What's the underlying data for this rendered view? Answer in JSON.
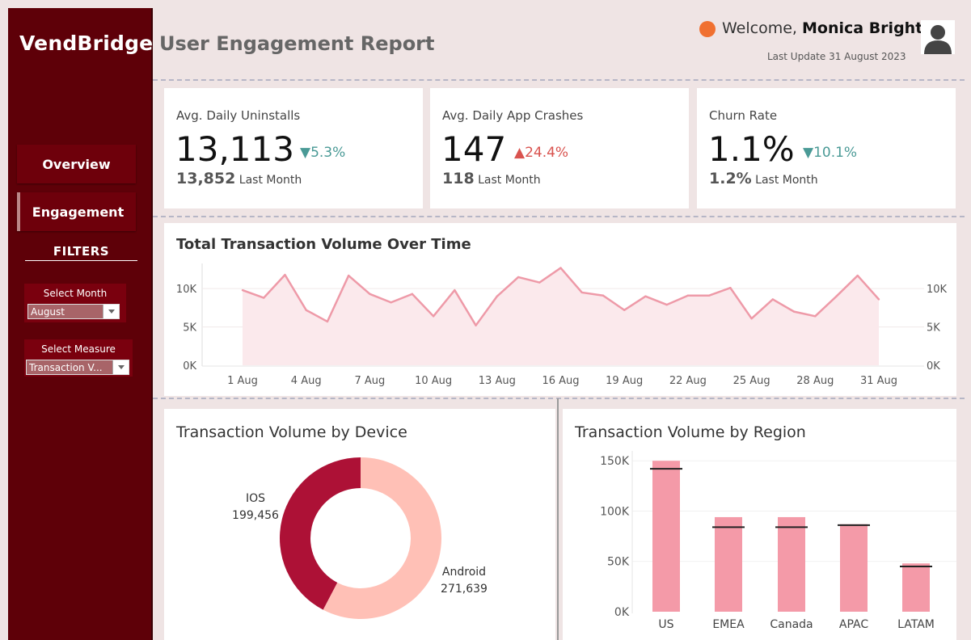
{
  "brand": "VendBridge",
  "page_title": "User Engagement Report",
  "header": {
    "welcome_prefix": "Welcome,",
    "user_name": "Monica Bright",
    "last_update": "Last Update 31 August 2023",
    "status_color": "#f07030"
  },
  "nav": {
    "overview": "Overview",
    "engagement": "Engagement"
  },
  "filters": {
    "title": "FILTERS",
    "month_label": "Select Month",
    "month_value": "August",
    "measure_label": "Select Measure",
    "measure_value": "Transaction V..."
  },
  "kpis": [
    {
      "label": "Avg. Daily Uninstalls",
      "value": "13,113",
      "delta": "▼5.3%",
      "direction": "down",
      "last_value": "13,852",
      "last_label": "Last Month"
    },
    {
      "label": "Avg. Daily App Crashes",
      "value": "147",
      "delta": "▲24.4%",
      "direction": "up",
      "last_value": "118",
      "last_label": "Last Month"
    },
    {
      "label": "Churn Rate",
      "value": "1.1%",
      "delta": "▼10.1%",
      "direction": "down",
      "last_value": "1.2%",
      "last_label": "Last Month"
    }
  ],
  "colors": {
    "sidebar": "#5e0008",
    "line": "#ee9aa8",
    "donut_ios": "#ad1136",
    "donut_android": "#ffc0b6",
    "bar": "#f49aa8",
    "target": "#222222"
  },
  "chart_data": [
    {
      "type": "area",
      "title": "Total Transaction Volume Over Time",
      "x": [
        1,
        2,
        3,
        4,
        5,
        6,
        7,
        8,
        9,
        10,
        11,
        12,
        13,
        14,
        15,
        16,
        17,
        18,
        19,
        20,
        21,
        22,
        23,
        24,
        25,
        26,
        27,
        28,
        29,
        30,
        31
      ],
      "x_tick_values": [
        1,
        4,
        7,
        10,
        13,
        16,
        19,
        22,
        25,
        28,
        31
      ],
      "x_tick_labels": [
        "1 Aug",
        "4 Aug",
        "7 Aug",
        "10 Aug",
        "13 Aug",
        "16 Aug",
        "19 Aug",
        "22 Aug",
        "25 Aug",
        "28 Aug",
        "31 Aug"
      ],
      "values": [
        9800,
        8800,
        11800,
        7200,
        5700,
        11700,
        9300,
        8200,
        9300,
        6400,
        9800,
        5200,
        9000,
        11500,
        10800,
        12700,
        9500,
        9100,
        7200,
        9000,
        7900,
        9100,
        9100,
        10100,
        6100,
        8600,
        7000,
        6400,
        9000,
        11700,
        8600
      ],
      "y_ticks": [
        "10K",
        "5K",
        "0K"
      ],
      "y_tick_values": [
        10000,
        5000,
        0
      ],
      "ylim": [
        0,
        13500
      ],
      "grid": true
    },
    {
      "type": "pie",
      "title": "Transaction Volume by Device",
      "categories": [
        "IOS",
        "Android"
      ],
      "values": [
        199456,
        271639
      ],
      "value_labels": [
        "199,456",
        "271,639"
      ]
    },
    {
      "type": "bar",
      "title": "Transaction Volume by Region",
      "categories": [
        "US",
        "EMEA",
        "Canada",
        "APAC",
        "LATAM"
      ],
      "values": [
        150000,
        94000,
        94000,
        87000,
        48000
      ],
      "targets": [
        142000,
        84000,
        84000,
        86000,
        45000
      ],
      "y_ticks": [
        "150K",
        "100K",
        "50K",
        "0K"
      ],
      "y_tick_values": [
        150000,
        100000,
        50000,
        0
      ],
      "ylim": [
        0,
        155000
      ],
      "grid": true
    }
  ]
}
